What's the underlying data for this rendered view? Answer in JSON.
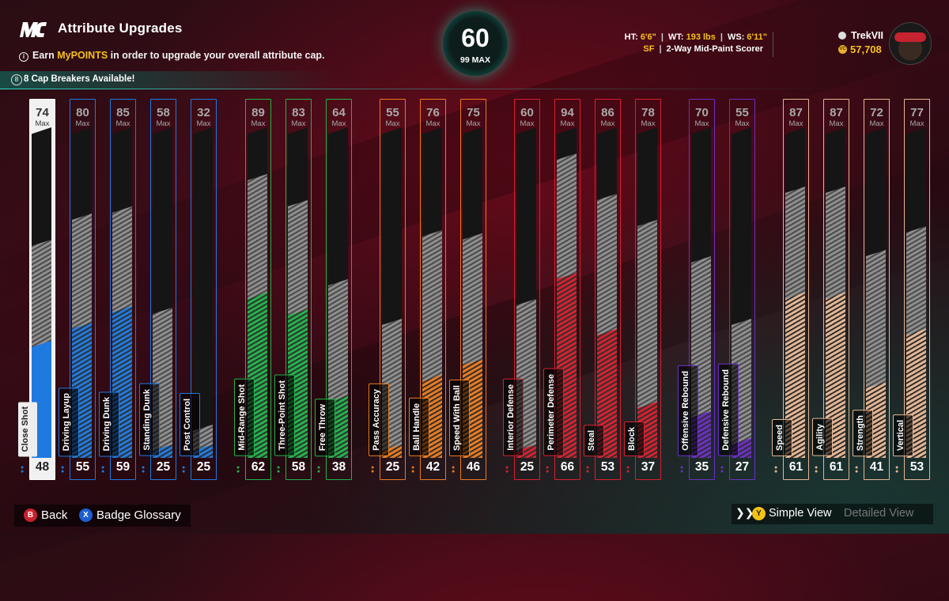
{
  "header": {
    "title": "Attribute Upgrades",
    "info_prefix": "Earn ",
    "info_highlight": "MyPOINTS",
    "info_suffix": " in order to upgrade your overall attribute cap.",
    "cap_breakers": "8 Cap Breakers Available!"
  },
  "overall": {
    "value": "60",
    "max": "99 MAX"
  },
  "player": {
    "ht_label": "HT:",
    "ht": "6'6\"",
    "wt_label": "WT:",
    "wt": "193 lbs",
    "ws_label": "WS:",
    "ws": "6'11\"",
    "position": "SF",
    "archetype": "2-Way Mid-Paint Scorer",
    "gamertag": "TrekVII",
    "vc": "57,708"
  },
  "max_label": "Max",
  "colors": {
    "inside": "#1f7ae0",
    "shooting": "#22b34a",
    "playmaking": "#ea7a1f",
    "defense": "#d8202f",
    "rebounding": "#6b2fc7",
    "physical": "#e5b693",
    "selected": "#ffffff",
    "accent": "#1ad7b4",
    "gold": "#f7c11b"
  },
  "attributes": [
    {
      "name": "Close Shot",
      "current": "48",
      "max": "74",
      "group": "selected",
      "cur_pct": 0.355,
      "pot_pct": 0.66
    },
    {
      "name": "Driving Layup",
      "current": "55",
      "max": "80",
      "group": "inside",
      "cur_pct": 0.41,
      "pot_pct": 0.74
    },
    {
      "name": "Driving Dunk",
      "current": "59",
      "max": "85",
      "group": "inside",
      "cur_pct": 0.46,
      "pot_pct": 0.76
    },
    {
      "name": "Standing Dunk",
      "current": "25",
      "max": "58",
      "group": "inside",
      "cur_pct": 0.04,
      "pot_pct": 0.455
    },
    {
      "name": "Post Control",
      "current": "25",
      "max": "32",
      "group": "inside",
      "cur_pct": 0.04,
      "pot_pct": 0.1
    },
    {
      "name": "Mid-Range Shot",
      "current": "62",
      "max": "89",
      "group": "shooting",
      "cur_pct": 0.5,
      "pot_pct": 0.86
    },
    {
      "name": "Three-Point Shot",
      "current": "58",
      "max": "83",
      "group": "shooting",
      "cur_pct": 0.45,
      "pot_pct": 0.78
    },
    {
      "name": "Free Throw",
      "current": "38",
      "max": "64",
      "group": "shooting",
      "cur_pct": 0.19,
      "pot_pct": 0.54
    },
    {
      "name": "Pass Accuracy",
      "current": "25",
      "max": "55",
      "group": "playmaking",
      "cur_pct": 0.04,
      "pot_pct": 0.42
    },
    {
      "name": "Ball Handle",
      "current": "42",
      "max": "76",
      "group": "playmaking",
      "cur_pct": 0.25,
      "pot_pct": 0.69
    },
    {
      "name": "Speed With Ball",
      "current": "46",
      "max": "75",
      "group": "playmaking",
      "cur_pct": 0.3,
      "pot_pct": 0.68
    },
    {
      "name": "Interior Defense",
      "current": "25",
      "max": "60",
      "group": "defense",
      "cur_pct": 0.04,
      "pot_pct": 0.48
    },
    {
      "name": "Perimeter Defense",
      "current": "66",
      "max": "94",
      "group": "defense",
      "cur_pct": 0.56,
      "pot_pct": 0.92
    },
    {
      "name": "Steal",
      "current": "53",
      "max": "86",
      "group": "defense",
      "cur_pct": 0.39,
      "pot_pct": 0.8
    },
    {
      "name": "Block",
      "current": "37",
      "max": "78",
      "group": "defense",
      "cur_pct": 0.17,
      "pot_pct": 0.72
    },
    {
      "name": "Offensive Rebound",
      "current": "35",
      "max": "70",
      "group": "rebounding",
      "cur_pct": 0.14,
      "pot_pct": 0.61
    },
    {
      "name": "Defensive Rebound",
      "current": "27",
      "max": "55",
      "group": "rebounding",
      "cur_pct": 0.06,
      "pot_pct": 0.42
    },
    {
      "name": "Speed",
      "current": "61",
      "max": "87",
      "group": "physical",
      "cur_pct": 0.5,
      "pot_pct": 0.82
    },
    {
      "name": "Agility",
      "current": "61",
      "max": "87",
      "group": "physical",
      "cur_pct": 0.5,
      "pot_pct": 0.82
    },
    {
      "name": "Strength",
      "current": "41",
      "max": "72",
      "group": "physical",
      "cur_pct": 0.23,
      "pot_pct": 0.63
    },
    {
      "name": "Vertical",
      "current": "53",
      "max": "77",
      "group": "physical",
      "cur_pct": 0.39,
      "pot_pct": 0.7
    }
  ],
  "footer": {
    "back_button": "B",
    "back_label": "Back",
    "glossary_button": "X",
    "glossary_label": "Badge Glossary",
    "view_button": "Y",
    "simple_view": "Simple View",
    "detailed_view": "Detailed View"
  }
}
